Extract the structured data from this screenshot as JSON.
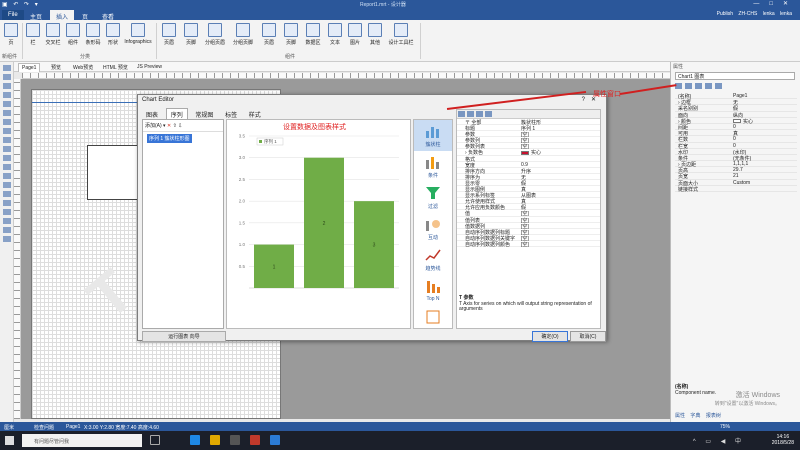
{
  "window": {
    "title": "Report1.mrt - 设计器",
    "controls": [
      "—",
      "□",
      "✕"
    ]
  },
  "ribbon_tabs": [
    {
      "label": "File",
      "active": false
    },
    {
      "label": "主页",
      "active": false
    },
    {
      "label": "插入",
      "active": true
    },
    {
      "label": "页",
      "active": false
    },
    {
      "label": "查看",
      "active": false
    }
  ],
  "user": {
    "publish": "Publish",
    "lang": "ZH-CHS",
    "name": "lenka lenka"
  },
  "ribbon_buttons": [
    {
      "label": "页"
    },
    {
      "label": "栏"
    },
    {
      "label": "交叉栏"
    },
    {
      "label": "组件"
    },
    {
      "label": "条形码"
    },
    {
      "label": "形状"
    },
    {
      "label": "Infographics"
    },
    {
      "label": "页眉"
    },
    {
      "label": "页脚"
    },
    {
      "label": "分组页眉"
    },
    {
      "label": "分组页脚"
    },
    {
      "label": "页眉"
    },
    {
      "label": "页脚"
    },
    {
      "label": "数据区"
    },
    {
      "label": "文本"
    },
    {
      "label": "图片"
    },
    {
      "label": "其他"
    },
    {
      "label": "设计工具栏"
    }
  ],
  "ribbon_groups": [
    {
      "label": "新组件"
    },
    {
      "label": "分类"
    },
    {
      "label": "组件"
    }
  ],
  "doc_tabs": [
    {
      "label": "Page1"
    },
    {
      "label": "预览"
    },
    {
      "label": "Web预览"
    },
    {
      "label": "HTML 预览"
    },
    {
      "label": "JS Preview"
    }
  ],
  "canvas": {
    "watermark": "T"
  },
  "dialog": {
    "title": "Chart Editor",
    "controls": [
      "?",
      "✕"
    ],
    "tabs": [
      {
        "label": "图表"
      },
      {
        "label": "序列",
        "active": true
      },
      {
        "label": "常规图"
      },
      {
        "label": "标签"
      },
      {
        "label": "样式"
      }
    ],
    "series_toolbar": {
      "add": "添加(A)",
      "remove": "✕",
      "up": "⇧",
      "down": "⇩"
    },
    "series_items": [
      "序列 1 簇状柱形图"
    ],
    "chart_types": [
      {
        "label": "簇状柱",
        "active": true
      },
      {
        "label": "条件"
      },
      {
        "label": "过滤"
      },
      {
        "label": "互动"
      },
      {
        "label": "趋势线"
      },
      {
        "label": "Top N"
      },
      {
        "label": ""
      }
    ],
    "properties": [
      {
        "k": "〒 全部",
        "v": "簇状柱形"
      },
      {
        "k": "标题",
        "v": "序列 1"
      },
      {
        "k": "参数",
        "v": "[空]"
      },
      {
        "k": "参数列",
        "v": "[空]"
      },
      {
        "k": "参数列表",
        "v": "[空]"
      },
      {
        "k": "› 负数色",
        "v": "实心",
        "swatch": "#c8102e"
      },
      {
        "k": "格式",
        "v": ""
      },
      {
        "k": "宽度",
        "v": "0.9"
      },
      {
        "k": "排序方向",
        "v": "升序"
      },
      {
        "k": "排序为",
        "v": "无"
      },
      {
        "k": "显示零",
        "v": "假"
      },
      {
        "k": "显示图例",
        "v": "真"
      },
      {
        "k": "显示系列标签",
        "v": "从图表"
      },
      {
        "k": "允许使用样式",
        "v": "真"
      },
      {
        "k": "允许应用负数颜色",
        "v": "假"
      },
      {
        "k": "值",
        "v": "[空]"
      },
      {
        "k": "值列表",
        "v": "[空]"
      },
      {
        "k": "值数据列",
        "v": "[空]"
      },
      {
        "k": "自动序列数据列标题",
        "v": "[空]"
      },
      {
        "k": "自动序列数据列关键字",
        "v": "[空]"
      },
      {
        "k": "自动序列数据列颜色",
        "v": "[空]"
      }
    ],
    "description": {
      "title": "T 参数",
      "body": "T Axis for series on which will output string representation of arguments"
    },
    "footer": {
      "run": "运行图表 向导",
      "ok": "确定(O)",
      "cancel": "取消(C)"
    }
  },
  "annotations": {
    "center": "设置数据及图表样式",
    "right": "属性窗口"
  },
  "properties_panel": {
    "header": "属性",
    "selector": "Chart1 图表",
    "rows": [
      {
        "k": "(名称)",
        "v": "Page1"
      },
      {
        "k": "› 边框",
        "v": "无"
      },
      {
        "k": "采名别别",
        "v": "假"
      },
      {
        "k": "面向",
        "v": "纵向"
      },
      {
        "k": "› 颜色",
        "v": "实心",
        "swatch": "#ffffff"
      },
      {
        "k": "间距",
        "v": "0"
      },
      {
        "k": "可用",
        "v": "真"
      },
      {
        "k": "栏数",
        "v": "0"
      },
      {
        "k": "栏宽",
        "v": "0"
      },
      {
        "k": "水印",
        "v": "(水印)"
      },
      {
        "k": "条件",
        "v": "(无条件)"
      },
      {
        "k": "› 页边距",
        "v": "1,1,1,1"
      },
      {
        "k": "页高",
        "v": "29.7"
      },
      {
        "k": "页宽",
        "v": "21"
      },
      {
        "k": "页面大小",
        "v": "Custom"
      },
      {
        "k": "链接样式",
        "v": ""
      }
    ],
    "description_title": "(名称)",
    "description_body": "Component name.",
    "tabs": [
      "属性",
      "字典",
      "报表树"
    ]
  },
  "statusbar": {
    "unit": "厘米",
    "check": "检查问题",
    "page": "Page1",
    "coords": "X:3.00 Y:2.80 宽度:7.40 高度:4.60",
    "zoom": "75%"
  },
  "taskbar": {
    "search": "有问题尽管问我",
    "time": "14:16",
    "date": "2018/5/28",
    "lang": "中"
  },
  "activation": {
    "line1": "激活 Windows",
    "line2": "转到\"设置\"以激活 Windows。"
  },
  "chart_data": {
    "type": "bar",
    "categories": [
      "1",
      "2",
      "3"
    ],
    "values": [
      1,
      3,
      2
    ],
    "series": [
      {
        "name": "序列 1",
        "values": [
          1,
          3,
          2
        ],
        "color": "#70ad47"
      }
    ],
    "ylim": [
      0,
      3.5
    ],
    "yticks": [
      "0.5",
      "1.0",
      "1.5",
      "2.0",
      "2.5",
      "3.0",
      "3.5"
    ],
    "grid": true,
    "legend": "top-left"
  }
}
